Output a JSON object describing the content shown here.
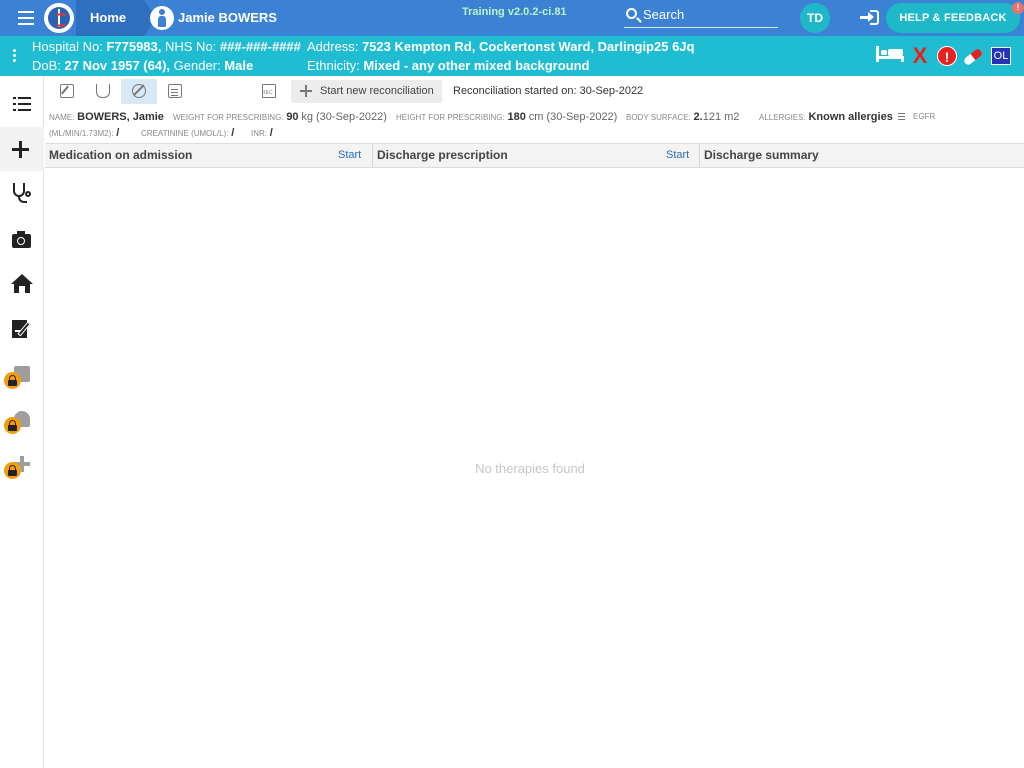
{
  "topbar": {
    "home_label": "Home",
    "patient_label": "Jamie BOWERS",
    "training_label": "Training v2.0.2-ci.81",
    "search_label": "Search",
    "avatar_initials": "TD",
    "help_label": "HELP & FEEDBACK",
    "help_badge": "!"
  },
  "banner": {
    "hospital_no_label": "Hospital No:",
    "hospital_no": "F775983,",
    "nhs_no_label": "NHS No:",
    "nhs_no": "###-###-####",
    "dob_label": "DoB:",
    "dob": "27 Nov 1957 (64),",
    "gender_label": "Gender:",
    "gender": "Male",
    "address_label": "Address:",
    "address": "7523 Kempton Rd, Cockertonst Ward, Darlingip25 6Jq",
    "ethnicity_label": "Ethnicity:",
    "ethnicity": "Mixed - any other mixed background",
    "alert_glyph": "!",
    "x_glyph": "X",
    "ol_badge": "OL",
    "icons": [
      "bed-icon",
      "cross-icon",
      "alert-icon",
      "pill-icon",
      "ol-badge"
    ],
    "colors": {
      "banner_bg": "#20bdd2",
      "alert_red": "#e8211f",
      "ol_blue": "#2533b7"
    }
  },
  "leftnav": {
    "items": [
      {
        "icon": "list-icon",
        "locked": false
      },
      {
        "icon": "plus-icon",
        "locked": false
      },
      {
        "icon": "stethoscope-icon",
        "locked": false
      },
      {
        "icon": "camera-icon",
        "locked": false
      },
      {
        "icon": "home-icon",
        "locked": false
      },
      {
        "icon": "document-sign-icon",
        "locked": false
      },
      {
        "icon": "clipboard-icon",
        "locked": true
      },
      {
        "icon": "person-walk-icon",
        "locked": true
      },
      {
        "icon": "plus-icon",
        "locked": true
      }
    ]
  },
  "toolbar": {
    "start_recon_label": "Start new reconciliation",
    "recon_started_label": "Reconciliation started on: 30-Sep-2022"
  },
  "info": {
    "name_label": "NAME:",
    "name_value": "BOWERS, Jamie",
    "weight_label": "WEIGHT FOR PRESCRIBING:",
    "weight_value": "90",
    "weight_unit": "kg (30-Sep-2022)",
    "height_label": "HEIGHT FOR PRESCRIBING:",
    "height_value": "180",
    "height_unit": "cm (30-Sep-2022)",
    "bsa_label": "BODY SURFACE:",
    "bsa_value": "2.",
    "bsa_unit": "121 m2",
    "allergies_label": "ALLERGIES:",
    "allergies_value": "Known allergies",
    "egfr_label": "EGFR",
    "egfr_unit_label": "(ML/MIN/1.73M2):",
    "egfr_value": "/",
    "creatinine_label": "CREATININE (UMOL/L):",
    "creatinine_value": "/",
    "inr_label": "INR:",
    "inr_value": "/"
  },
  "table": {
    "col_admission": "Medication on admission",
    "col_discharge": "Discharge prescription",
    "col_summary": "Discharge summary",
    "start_label": "Start",
    "empty_message": "No therapies found"
  }
}
